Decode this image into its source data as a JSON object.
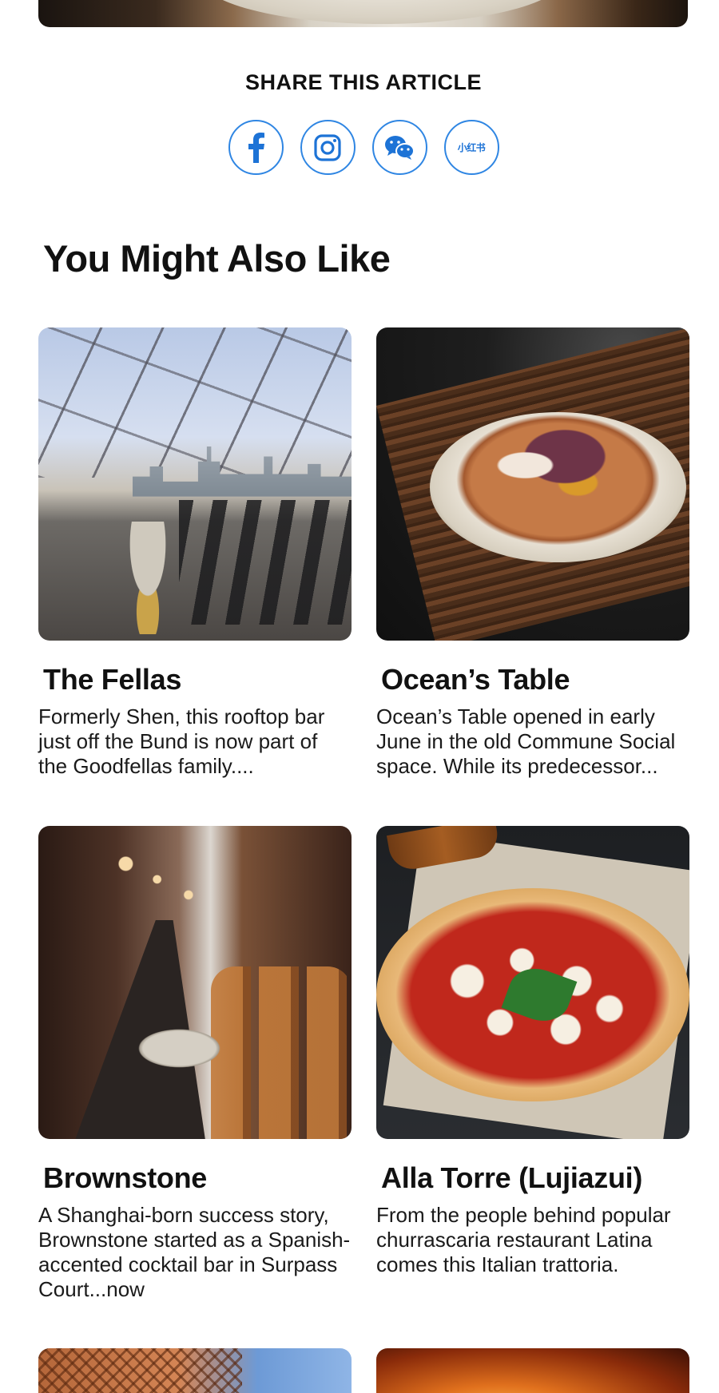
{
  "share": {
    "title": "SHARE THIS ARTICLE",
    "buttons": [
      {
        "name": "facebook",
        "icon": "facebook-icon"
      },
      {
        "name": "instagram",
        "icon": "instagram-icon"
      },
      {
        "name": "wechat",
        "icon": "wechat-icon"
      },
      {
        "name": "xiaohongshu",
        "icon": "xiaohongshu-icon",
        "label": "小红书"
      }
    ],
    "accent_color": "#2f86e3"
  },
  "related": {
    "heading": "You Might Also Like",
    "cards": [
      {
        "title": "The Fellas",
        "description": "Formerly Shen, this rooftop bar just off the Bund is now part of the Goodfellas family...."
      },
      {
        "title": "Ocean’s Table",
        "description": "Ocean’s Table opened in early June in the old Commune Social space. While its predecessor..."
      },
      {
        "title": "Brownstone",
        "description": "A Shanghai-born success story, Brownstone started as a Spanish-accented cocktail bar in Surpass Court...now"
      },
      {
        "title": "Alla Torre (Lujiazui)",
        "description": "From the people behind popular churrascaria restaurant Latina comes this Italian trattoria."
      }
    ]
  }
}
